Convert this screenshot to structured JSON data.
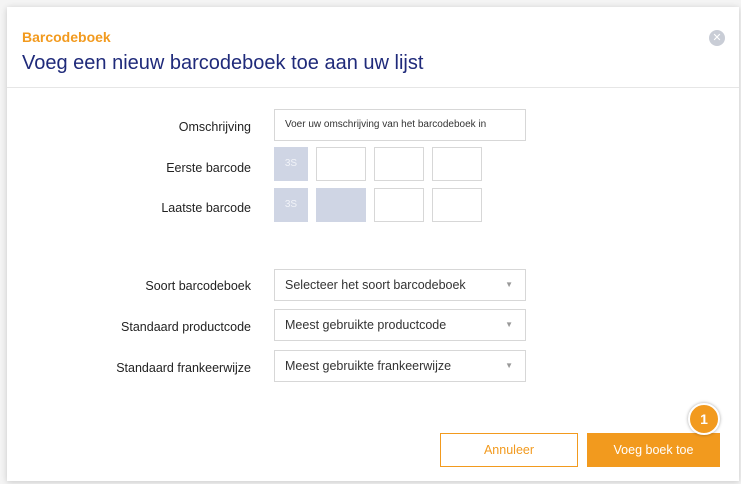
{
  "dialog": {
    "kicker": "Barcodeboek",
    "title": "Voeg een nieuw barcodeboek toe aan uw lijst"
  },
  "form": {
    "omschrijving": {
      "label": "Omschrijving",
      "placeholder": "Voer uw omschrijving van het barcodeboek in"
    },
    "eerste_barcode": {
      "label": "Eerste barcode",
      "prefix": "3S"
    },
    "laatste_barcode": {
      "label": "Laatste barcode",
      "prefix": "3S"
    },
    "soort": {
      "label": "Soort barcodeboek",
      "value": "Selecteer het soort barcodeboek"
    },
    "productcode": {
      "label": "Standaard productcode",
      "value": "Meest gebruikte productcode"
    },
    "frankeerwijze": {
      "label": "Standaard frankeerwijze",
      "value": "Meest gebruikte frankeerwijze"
    }
  },
  "buttons": {
    "cancel": "Annuleer",
    "add": "Voeg boek toe"
  },
  "annotation": {
    "step": "1"
  },
  "colors": {
    "accent": "#f29a1e",
    "title": "#1f2a7a",
    "disabled": "#cfd5e4"
  }
}
